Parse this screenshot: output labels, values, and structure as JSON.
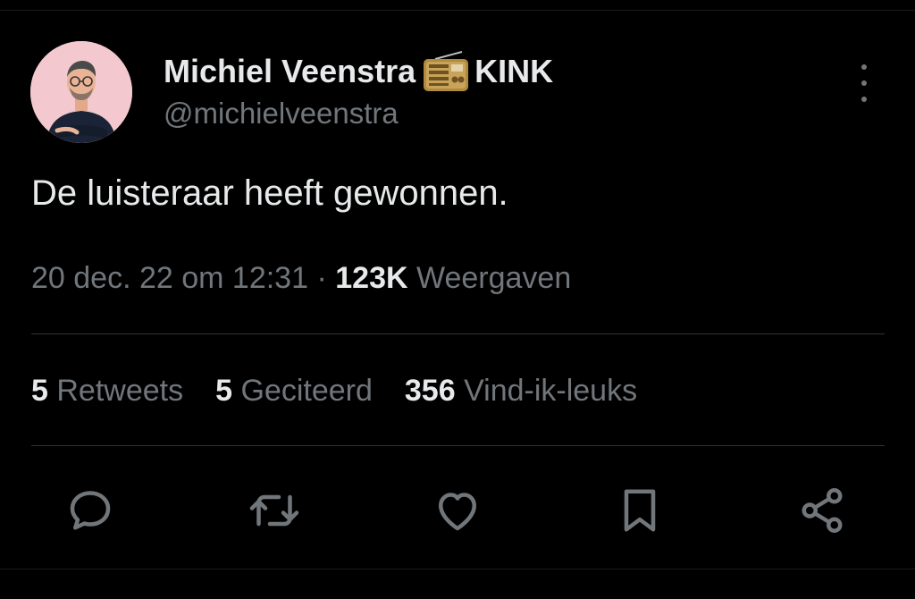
{
  "tweet": {
    "author": {
      "display_name": "Michiel Veenstra",
      "name_suffix": "KINK",
      "name_emoji": "radio-icon",
      "handle": "@michielveenstra"
    },
    "text": "De luisteraar heeft gewonnen.",
    "timestamp": "20 dec. 22 om 12:31",
    "separator": "·",
    "views_count": "123K",
    "views_label": "Weergaven",
    "stats": {
      "retweets_count": "5",
      "retweets_label": "Retweets",
      "quotes_count": "5",
      "quotes_label": "Geciteerd",
      "likes_count": "356",
      "likes_label": "Vind-ik-leuks"
    }
  },
  "actions": [
    {
      "name": "reply",
      "icon": "speech-bubble-icon"
    },
    {
      "name": "retweet",
      "icon": "retweet-icon"
    },
    {
      "name": "like",
      "icon": "heart-icon"
    },
    {
      "name": "bookmark",
      "icon": "bookmark-icon"
    },
    {
      "name": "share",
      "icon": "share-icon"
    }
  ],
  "colors": {
    "background": "#000000",
    "primary_text": "#e7e9ea",
    "secondary_text": "#71767b",
    "divider": "#2f3336",
    "avatar_background": "#f3c9cf"
  }
}
